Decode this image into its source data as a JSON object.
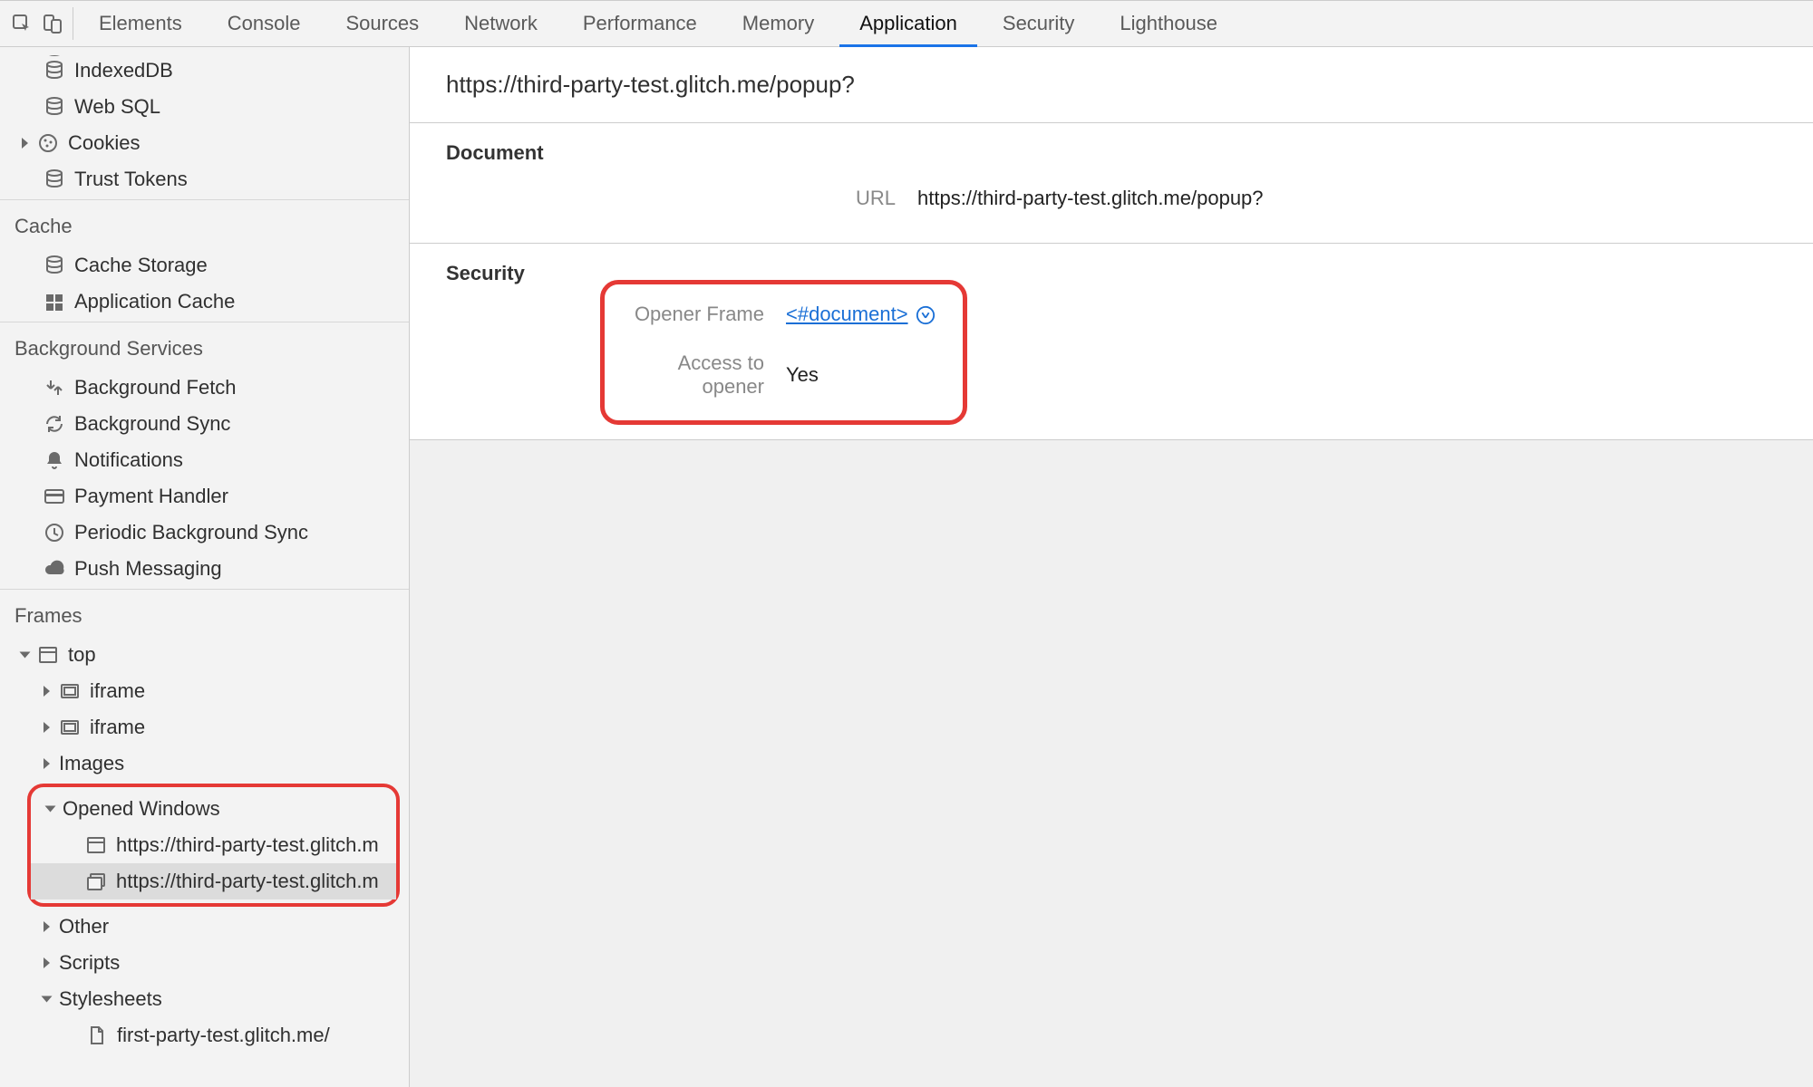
{
  "tabs": {
    "elements": "Elements",
    "console": "Console",
    "sources": "Sources",
    "network": "Network",
    "performance": "Performance",
    "memory": "Memory",
    "application": "Application",
    "security": "Security",
    "lighthouse": "Lighthouse"
  },
  "sidebar": {
    "storage": {
      "indexeddb": "IndexedDB",
      "websql": "Web SQL",
      "cookies": "Cookies",
      "trusttokens": "Trust Tokens"
    },
    "cache": {
      "heading": "Cache",
      "cachestorage": "Cache Storage",
      "appcache": "Application Cache"
    },
    "bg": {
      "heading": "Background Services",
      "fetch": "Background Fetch",
      "sync": "Background Sync",
      "notifications": "Notifications",
      "payment": "Payment Handler",
      "periodic": "Periodic Background Sync",
      "push": "Push Messaging"
    },
    "frames": {
      "heading": "Frames",
      "top": "top",
      "iframe1": "iframe",
      "iframe2": "iframe",
      "images": "Images",
      "opened": "Opened Windows",
      "ow1": "https://third-party-test.glitch.m",
      "ow2": "https://third-party-test.glitch.m",
      "other": "Other",
      "scripts": "Scripts",
      "stylesheets": "Stylesheets",
      "ss1": "first-party-test.glitch.me/"
    }
  },
  "detail": {
    "title": "https://third-party-test.glitch.me/popup?",
    "documentHeading": "Document",
    "urlLabel": "URL",
    "urlValue": "https://third-party-test.glitch.me/popup?",
    "securityHeading": "Security",
    "openerFrameLabel": "Opener Frame",
    "openerFrameValue": "<#document>",
    "accessLabel": "Access to opener",
    "accessValue": "Yes"
  }
}
